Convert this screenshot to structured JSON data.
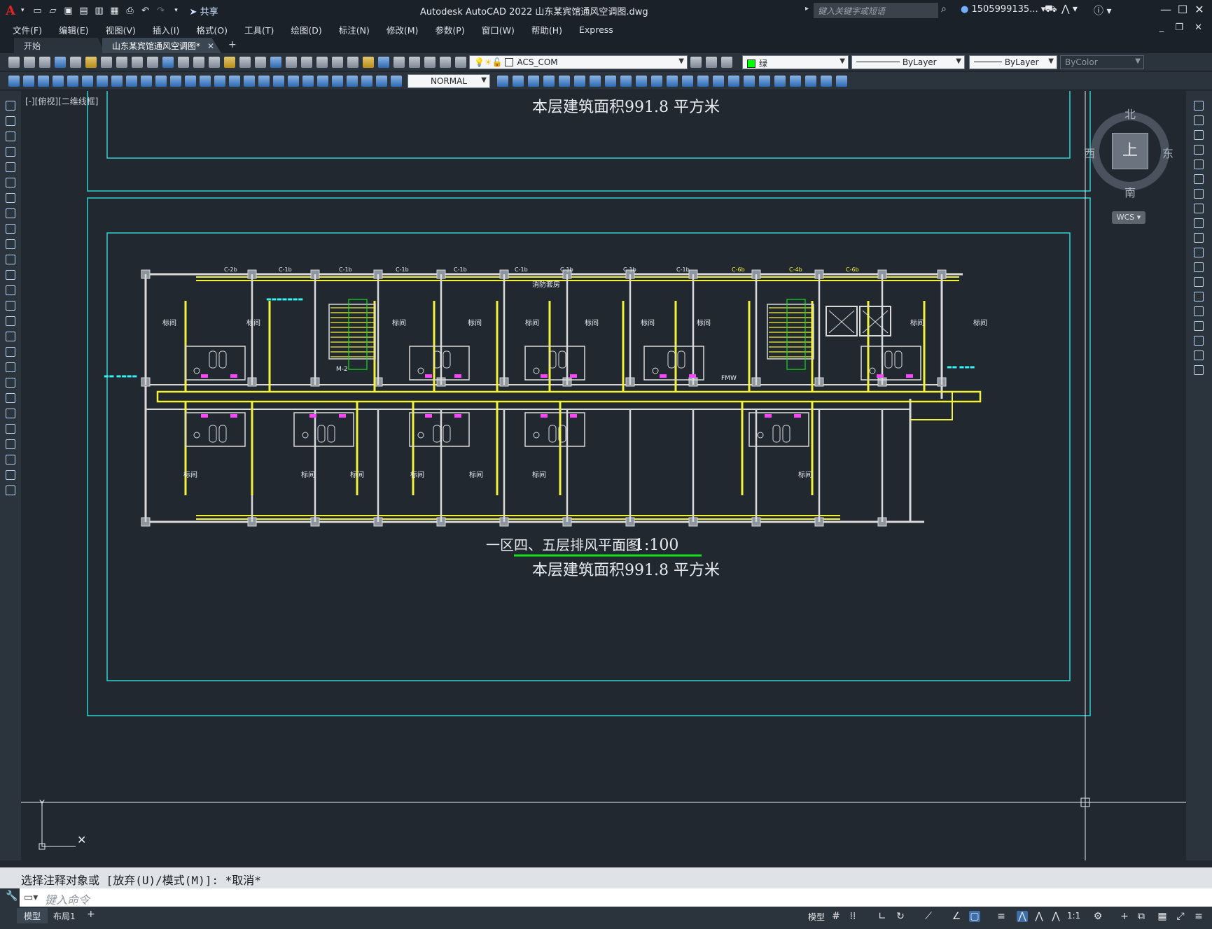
{
  "titlebar": {
    "logo": "A",
    "share_label": "共享",
    "title": "Autodesk AutoCAD 2022    山东某宾馆通风空调图.dwg",
    "search_placeholder": "键入关键字或短语",
    "user": "1505999135...",
    "qa_icons": [
      "new-icon",
      "open-icon",
      "save-icon",
      "save-as-icon",
      "publish-icon",
      "plot-icon",
      "print-icon",
      "undo-icon",
      "redo-icon",
      "share-icon"
    ]
  },
  "menu": [
    "文件(F)",
    "编辑(E)",
    "视图(V)",
    "插入(I)",
    "格式(O)",
    "工具(T)",
    "绘图(D)",
    "标注(N)",
    "修改(M)",
    "参数(P)",
    "窗口(W)",
    "帮助(H)",
    "Express"
  ],
  "tabs": {
    "start": "开始",
    "drawing": "山东某宾馆通风空调图*",
    "close_glyph": "✕",
    "add_glyph": "+"
  },
  "toolbar": {
    "layer_name": "ACS_COM",
    "color_name": "绿",
    "color_swatch": "#00ff00",
    "linetype": "ByLayer",
    "lineweight": "ByLayer",
    "plotstyle": "ByColor",
    "dimstyle": "NORMAL"
  },
  "viewport": {
    "label": "[-][俯视][二维线框]"
  },
  "drawing": {
    "area_text": "本层建筑面积991.8 平方米",
    "plan_title": "一区四、五层排风平面图",
    "plan_scale": "1:100",
    "room_label": "标间",
    "corridor_label": "消防套房",
    "fire_label": "FMW",
    "door_label": "M-2",
    "fan_labels_top": [
      "C-2b",
      "C-1b",
      "C-1b",
      "C-1b",
      "C-1b",
      "C-1b",
      "C-1b",
      "C-1b",
      "C-1b",
      "C-6b",
      "C-4b",
      "C-6b"
    ],
    "colors": {
      "frame": "#2ed3d3",
      "wall": "#d9d9d9",
      "duct": "#f2f23a",
      "accent": "#18e01e",
      "cyan_text": "#34f4f4"
    }
  },
  "viewcube": {
    "north": "北",
    "south": "南",
    "east": "东",
    "west": "西",
    "face": "上",
    "wcs": "WCS"
  },
  "command": {
    "history": "选择注释对象或 [放弃(U)/模式(M)]: *取消*",
    "placeholder": "键入命令"
  },
  "status": {
    "layout_model": "模型",
    "layout_1": "布局1",
    "model_space": "模型",
    "scale": "1:1"
  }
}
